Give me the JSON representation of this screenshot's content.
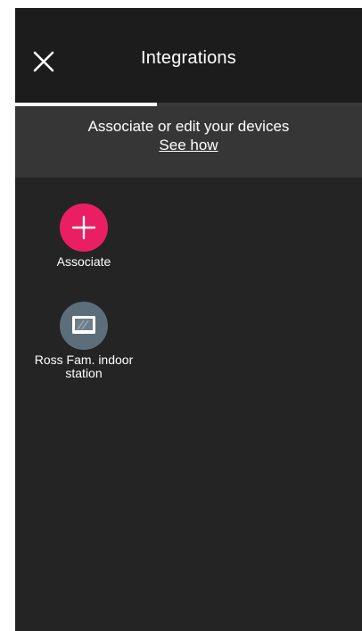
{
  "header": {
    "title": "Integrations",
    "close_icon": "close-icon"
  },
  "tabs": {
    "active_index": 0
  },
  "banner": {
    "text": "Associate or edit your devices",
    "link": "See how"
  },
  "devices": [
    {
      "label": "Associate",
      "icon": "plus-icon",
      "color": "#e91e63"
    },
    {
      "label": "Ross Fam. indoor station",
      "icon": "monitor-icon",
      "color": "#5c6e7a"
    }
  ],
  "colors": {
    "background": "#242424",
    "header": "#1c1c1c",
    "banner": "#363636",
    "accent": "#e91e63"
  }
}
